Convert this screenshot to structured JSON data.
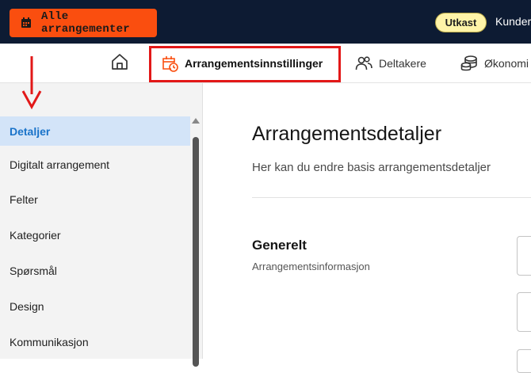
{
  "topbar": {
    "all_events_label": "Alle arrangementer",
    "status_badge": "Utkast",
    "customer_label": "Kunder"
  },
  "tabs": {
    "settings_label": "Arrangementsinnstillinger",
    "participants_label": "Deltakere",
    "economy_label": "Økonomi"
  },
  "sidebar": {
    "items": [
      {
        "label": "Detaljer",
        "active": true
      },
      {
        "label": "Digitalt arrangement"
      },
      {
        "label": "Felter"
      },
      {
        "label": "Kategorier"
      },
      {
        "label": "Spørsmål"
      },
      {
        "label": "Design"
      },
      {
        "label": "Kommunikasjon"
      }
    ]
  },
  "main": {
    "title": "Arrangementsdetaljer",
    "subtitle": "Her kan du endre basis arrangementsdetaljer",
    "section": {
      "title": "Generelt",
      "subtitle": "Arrangementsinformasjon"
    }
  },
  "colors": {
    "topbar_bg": "#0d1b33",
    "accent_orange": "#fa4e0f",
    "badge_bg": "#fff4a8",
    "active_item_bg": "#d3e4f8",
    "active_item_text": "#1a73c9",
    "annotation_red": "#e21818"
  },
  "icons": {
    "all_events": "calendar-icon",
    "home": "home-icon",
    "settings": "calendar-clock-icon",
    "participants": "people-icon",
    "economy": "coins-icon"
  }
}
